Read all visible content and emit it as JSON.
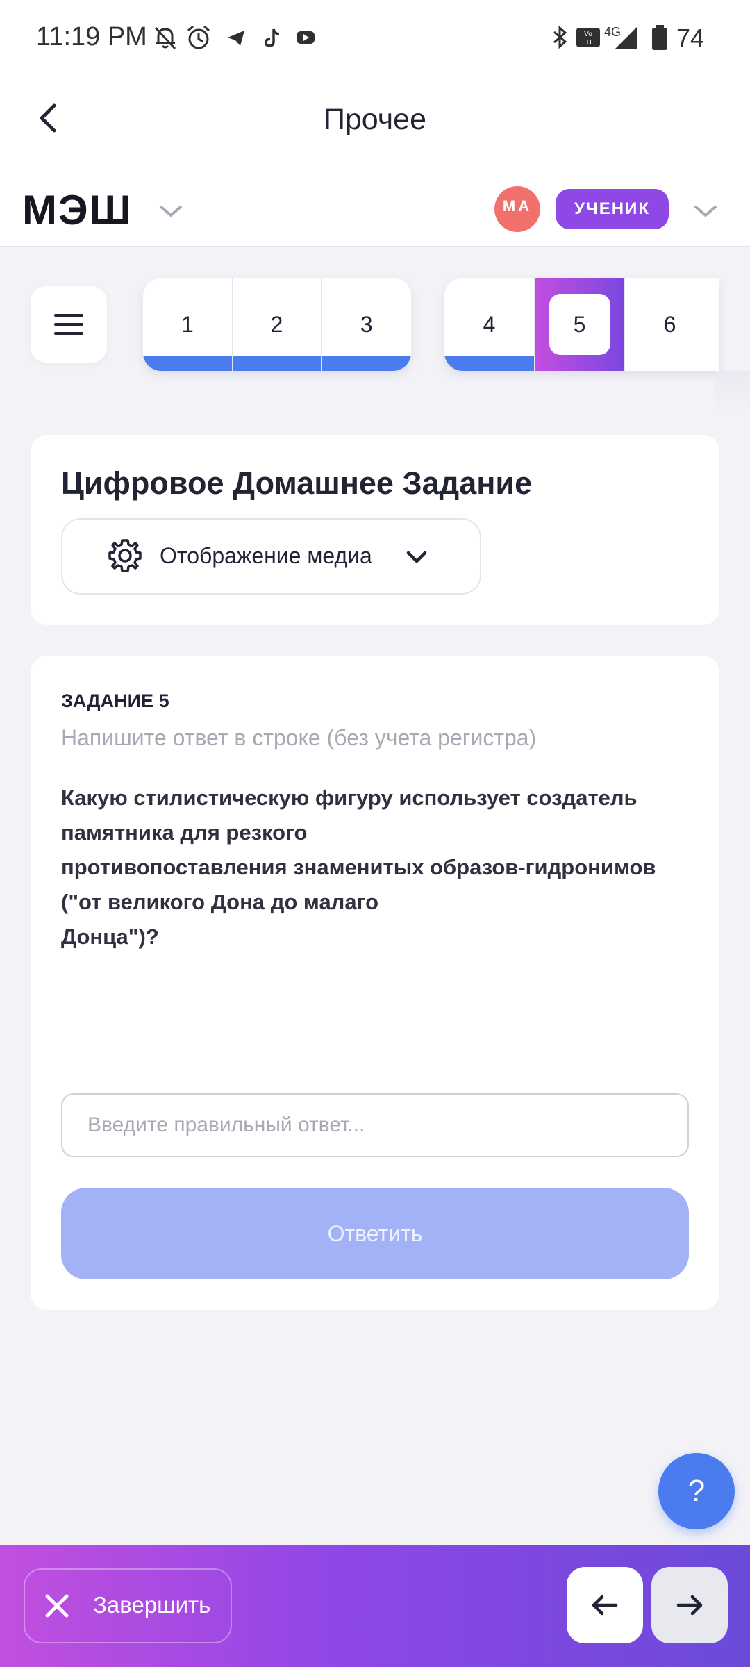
{
  "status_bar": {
    "time": "11:19 PM",
    "network": "4G",
    "battery": "74",
    "icons": [
      "bell-off-icon",
      "alarm-icon",
      "telegram-icon",
      "tiktok-icon",
      "youtube-icon",
      "bluetooth-icon",
      "volte-icon",
      "signal-icon",
      "battery-icon"
    ]
  },
  "app_bar": {
    "title": "Прочее",
    "back_icon": "chevron-left-icon"
  },
  "header": {
    "logo": "МЭШ",
    "avatar_initials": "МА",
    "role": "УЧЕНИК"
  },
  "task_nav": {
    "groups": [
      [
        {
          "label": "1",
          "done": true
        },
        {
          "label": "2",
          "done": true
        },
        {
          "label": "3",
          "done": true
        }
      ],
      [
        {
          "label": "4",
          "done": true
        },
        {
          "label": "5",
          "active": true
        },
        {
          "label": "6",
          "done": false
        }
      ]
    ]
  },
  "homework": {
    "title": "Цифровое Домашнее Задание",
    "media_label": "Отображение медиа"
  },
  "task": {
    "number": "ЗАДАНИЕ 5",
    "hint": "Напишите ответ в строке (без учета регистра)",
    "question": "Какую стилистическую фигуру использует создатель\nпамятника для резкого\nпротивопоставления знаменитых образов-гидронимов\n(\"от великого Дона до малаго\nДонца\")?",
    "answer_placeholder": "Введите правильный ответ...",
    "answer_value": "",
    "submit_label": "Ответить"
  },
  "help": {
    "label": "?"
  },
  "bottom_bar": {
    "finish_label": "Завершить"
  },
  "colors": {
    "accent_blue": "#4a7cf0",
    "accent_purple": "#8f47e6",
    "gradient_start": "#c24fdf",
    "avatar": "#f2706c",
    "submit_disabled": "#a3b2f7"
  }
}
